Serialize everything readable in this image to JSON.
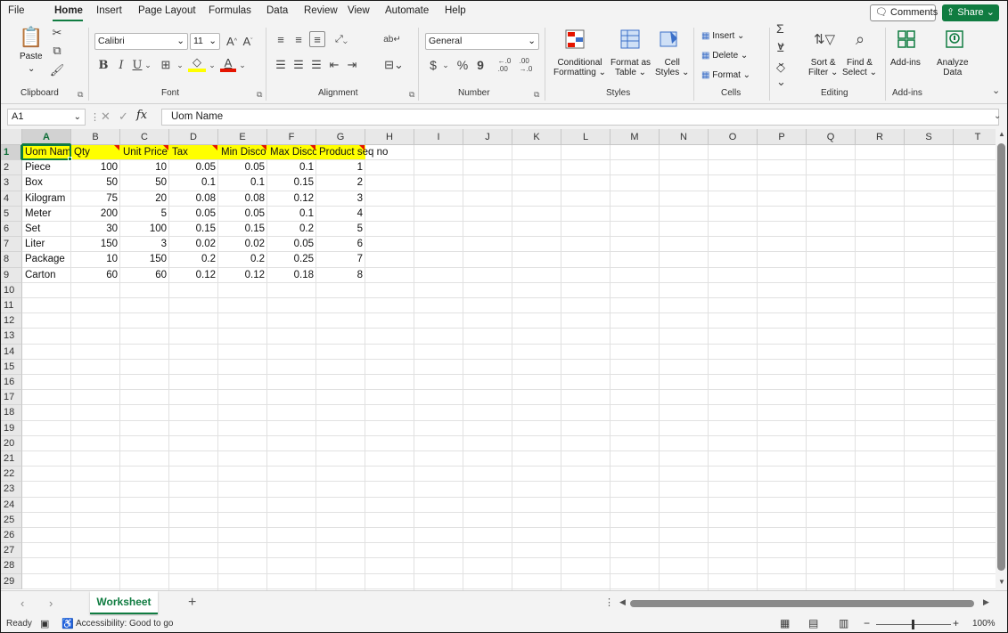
{
  "menu": {
    "items": [
      "File",
      "Home",
      "Insert",
      "Page Layout",
      "Formulas",
      "Data",
      "Review",
      "View",
      "Automate",
      "Help"
    ],
    "comments": "Comments",
    "share": "Share"
  },
  "ribbon": {
    "clipboard": {
      "paste": "Paste",
      "label": "Clipboard"
    },
    "font": {
      "name": "Calibri",
      "size": "11",
      "label": "Font",
      "bold": "B",
      "italic": "I",
      "underline": "U"
    },
    "alignment": {
      "label": "Alignment"
    },
    "number": {
      "format": "General",
      "currency": "$",
      "percent": "%",
      "comma": "9",
      "label": "Number"
    },
    "styles": {
      "conditional": [
        "Conditional",
        "Formatting"
      ],
      "format_table": [
        "Format as",
        "Table"
      ],
      "cell_styles": [
        "Cell",
        "Styles"
      ],
      "label": "Styles"
    },
    "cells": {
      "insert": "Insert",
      "delete": "Delete",
      "format": "Format",
      "label": "Cells"
    },
    "editing": {
      "sort": [
        "Sort &",
        "Filter"
      ],
      "find": [
        "Find &",
        "Select"
      ],
      "label": "Editing"
    },
    "addins": {
      "addins": "Add-ins",
      "analyze": [
        "Analyze",
        "Data"
      ],
      "label": "Add-ins"
    }
  },
  "formula_bar": {
    "name_box": "A1",
    "fx": "fx",
    "content": "Uom Name"
  },
  "columns": [
    "A",
    "B",
    "C",
    "D",
    "E",
    "F",
    "G",
    "H",
    "I",
    "J",
    "K",
    "L",
    "M",
    "N",
    "O",
    "P",
    "Q",
    "R",
    "S",
    "T"
  ],
  "rows": [
    "1",
    "2",
    "3",
    "4",
    "5",
    "6",
    "7",
    "8",
    "9",
    "10",
    "11",
    "12",
    "13",
    "14",
    "15",
    "16",
    "17",
    "18",
    "19",
    "20",
    "21",
    "22",
    "23",
    "24",
    "25",
    "26",
    "27",
    "28",
    "29"
  ],
  "headers": [
    "Uom Nam",
    "Qty",
    "Unit Price",
    "Tax",
    "Min Disco",
    "Max Disco",
    "Product seq no"
  ],
  "table": [
    [
      "Piece",
      "100",
      "10",
      "0.05",
      "0.05",
      "0.1",
      "1"
    ],
    [
      "Box",
      "50",
      "50",
      "0.1",
      "0.1",
      "0.15",
      "2"
    ],
    [
      "Kilogram",
      "75",
      "20",
      "0.08",
      "0.08",
      "0.12",
      "3"
    ],
    [
      "Meter",
      "200",
      "5",
      "0.05",
      "0.05",
      "0.1",
      "4"
    ],
    [
      "Set",
      "30",
      "100",
      "0.15",
      "0.15",
      "0.2",
      "5"
    ],
    [
      "Liter",
      "150",
      "3",
      "0.02",
      "0.02",
      "0.05",
      "6"
    ],
    [
      "Package",
      "10",
      "150",
      "0.2",
      "0.2",
      "0.25",
      "7"
    ],
    [
      "Carton",
      "60",
      "60",
      "0.12",
      "0.12",
      "0.18",
      "8"
    ]
  ],
  "sheet_tab": "Worksheet",
  "status": {
    "ready": "Ready",
    "accessibility": "Accessibility: Good to go",
    "zoom": "100%"
  },
  "colors": {
    "accent": "#107c41",
    "header_fill": "#ffff00",
    "comment": "#e51400"
  }
}
